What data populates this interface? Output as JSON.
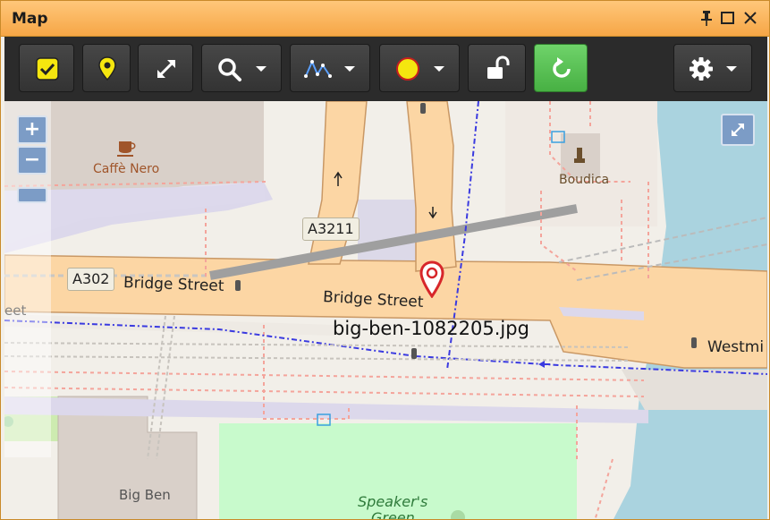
{
  "window": {
    "title": "Map"
  },
  "window_controls": [
    {
      "name": "pin-icon",
      "glyph": "🖈"
    },
    {
      "name": "maximize-icon",
      "glyph": "☐"
    },
    {
      "name": "close-icon",
      "glyph": "✕"
    }
  ],
  "toolbar": {
    "buttons": [
      {
        "name": "select-all-button",
        "icon": "checkbox-icon"
      },
      {
        "name": "marker-button",
        "icon": "map-pin-icon"
      },
      {
        "name": "fit-extent-button",
        "icon": "expand-arrows-icon"
      },
      {
        "name": "search-button",
        "icon": "search-icon",
        "dropdown": true
      },
      {
        "name": "track-button",
        "icon": "track-line-icon",
        "dropdown": true
      },
      {
        "name": "marker-color-button",
        "icon": "color-circle-icon",
        "dropdown": true,
        "color": "#f5e60f"
      },
      {
        "name": "lock-button",
        "icon": "unlock-icon"
      },
      {
        "name": "refresh-button",
        "icon": "refresh-icon",
        "active": true
      },
      {
        "name": "settings-button",
        "icon": "gear-icon",
        "dropdown": true
      }
    ]
  },
  "map": {
    "zoom_in": "+",
    "zoom_out": "−",
    "labels": {
      "cafe": "Caffè Nero",
      "boudica": "Boudica",
      "a3211": "A3211",
      "a302": "A302",
      "bridge_street_1": "Bridge Street",
      "bridge_street_2": "Bridge Street",
      "westminster": "Westmi",
      "eet": "eet",
      "big_ben": "Big Ben",
      "speakers_1": "Speaker's",
      "speakers_2": "Green"
    },
    "marker": {
      "label": "big-ben-1082205.jpg",
      "color": "#d7262a"
    }
  },
  "colors": {
    "titlebar": "#f6a646",
    "toolbar": "#2b2b2b",
    "road_major": "#fcd6a4",
    "water": "#aad3df",
    "park": "#c8facc",
    "building": "#d9d0c9"
  }
}
